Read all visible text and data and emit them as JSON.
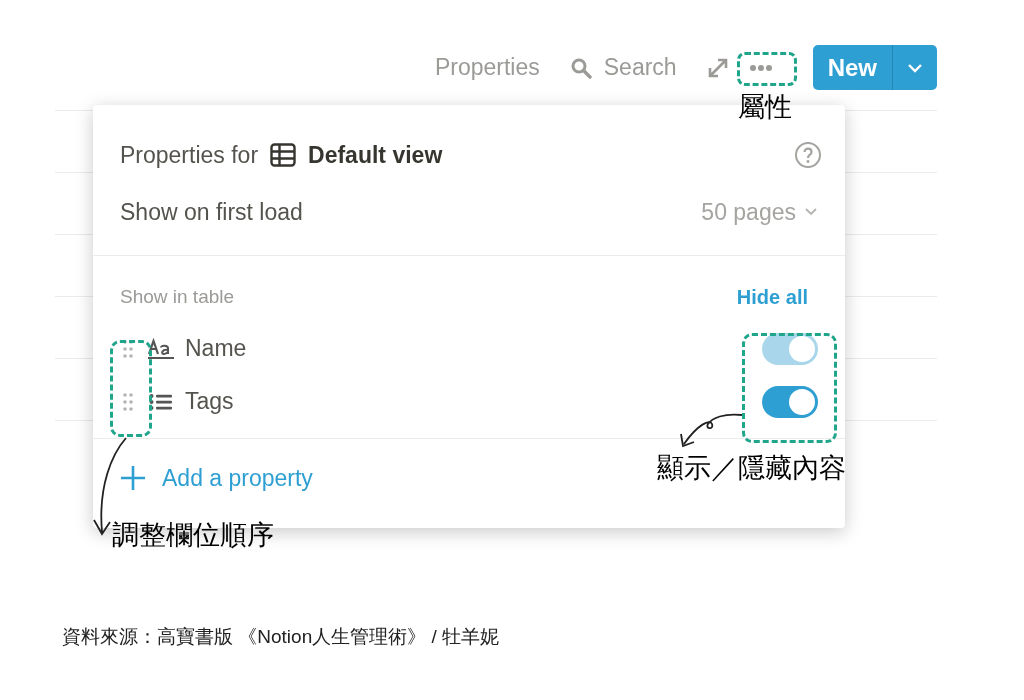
{
  "toolbar": {
    "items": [
      {
        "label": "Properties"
      },
      {
        "label": "Search"
      }
    ],
    "new_button": "New"
  },
  "popup": {
    "title_prefix": "Properties for",
    "view_name": "Default view",
    "first_load": {
      "label": "Show on first load",
      "value": "50 pages"
    },
    "section": "Show in table",
    "hide_all": "Hide all",
    "properties": [
      {
        "name": "Name",
        "kind": "title",
        "on": true,
        "disabled": true
      },
      {
        "name": "Tags",
        "kind": "multi_select",
        "on": true,
        "disabled": false
      }
    ],
    "add": "Add a property"
  },
  "annotations": [
    {
      "text": "屬性"
    },
    {
      "text": "顯示／隱藏內容"
    },
    {
      "text": "調整欄位順序"
    }
  ],
  "caption": "資料來源：高寶書版 《Notion人生管理術》 / 牡羊妮"
}
